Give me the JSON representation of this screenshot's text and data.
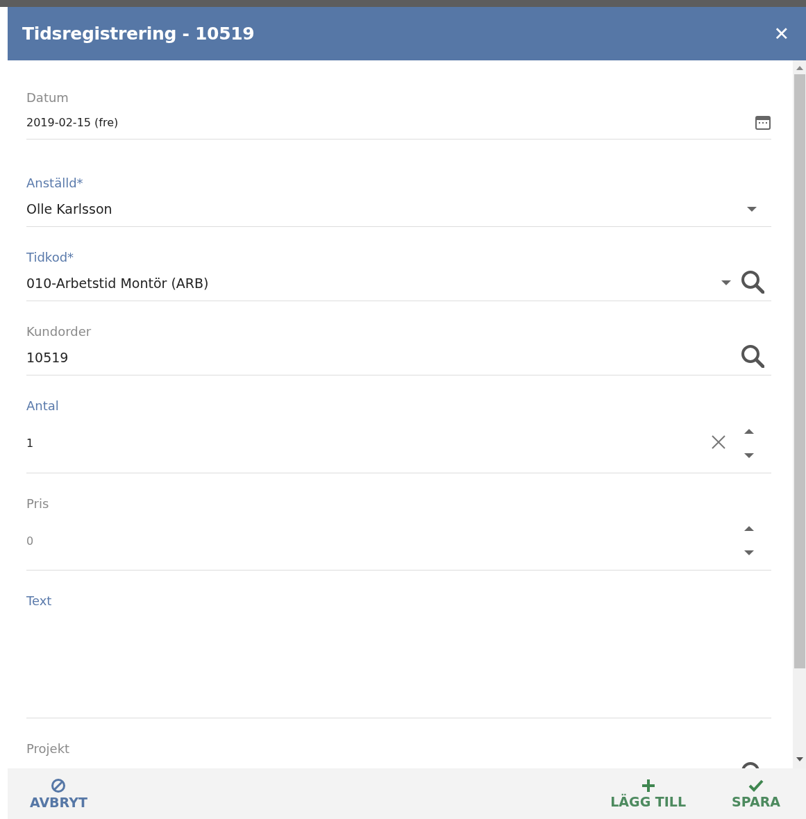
{
  "dialog": {
    "title": "Tidsregistrering - 10519",
    "close": "✕"
  },
  "fields": [
    {
      "kind": "date",
      "label": "Datum",
      "color": "#8a8a8a",
      "value": "2019-02-15 (fre)"
    },
    {
      "kind": "select",
      "label": "Anställd*",
      "color": "#5a7aab",
      "value": "Olle Karlsson"
    },
    {
      "kind": "select-lookup",
      "label": "Tidkod*",
      "color": "#5a7aab",
      "value": "010-Arbetstid Montör (ARB)"
    },
    {
      "kind": "lookup",
      "label": "Kundorder",
      "color": "#8a8a8a",
      "value": "10519"
    },
    {
      "kind": "number-clear",
      "label": "Antal",
      "color": "#5a7aab",
      "value": "1"
    },
    {
      "kind": "number",
      "label": "Pris",
      "color": "#8a8a8a",
      "placeholder": "0"
    },
    {
      "kind": "textarea",
      "label": "Text",
      "color": "#5a7aab"
    },
    {
      "kind": "lookup",
      "label": "Projekt",
      "color": "#8a8a8a"
    }
  ],
  "footer": {
    "cancel": "AVBRYT",
    "add": "LÄGG TILL",
    "save": "SPARA"
  }
}
